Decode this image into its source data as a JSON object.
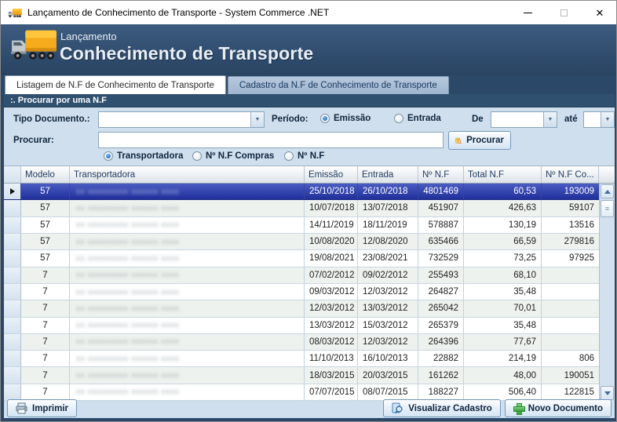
{
  "window": {
    "title": "Lançamento de Conhecimento de Transporte - System Commerce .NET",
    "close_glyph": "✕"
  },
  "banner": {
    "subtitle": "Lançamento",
    "title": "Conhecimento de Transporte"
  },
  "tabs": [
    {
      "label": "Listagem de N.F de Conhecimento de Transporte",
      "active": true
    },
    {
      "label": "Cadastro da N.F de Conhecimento de Transporte",
      "active": false
    }
  ],
  "search": {
    "section_title": ":. Procurar por uma N.F",
    "tipo_documento_label": "Tipo Documento.:",
    "tipo_documento_value": "",
    "periodo_label": "Período:",
    "periodo_options": [
      {
        "label": "Emissão",
        "selected": true
      },
      {
        "label": "Entrada",
        "selected": false
      }
    ],
    "de_label": "De",
    "de_value": "",
    "ate_label": "até",
    "ate_value": "",
    "procurar_label": "Procurar:",
    "procurar_value": "",
    "procurar_button": "Procurar",
    "filter_options": [
      {
        "label": "Transportadora",
        "selected": true
      },
      {
        "label": "Nº N.F Compras",
        "selected": false
      },
      {
        "label": "Nº N.F",
        "selected": false
      }
    ]
  },
  "grid": {
    "columns": {
      "modelo": "Modelo",
      "transportadora": "Transportadora",
      "emissao": "Emissão",
      "entrada": "Entrada",
      "nf": "Nº N.F",
      "total": "Total N.F",
      "nf_compras": "Nº N.F Co..."
    },
    "transportadora_redaction_note": "names blurred in source image",
    "redaction_placeholder": "xx xxxxxxxxx xxxxxx xxxx",
    "rows": [
      {
        "modelo": "57",
        "emissao": "25/10/2018",
        "entrada": "26/10/2018",
        "nf": "4801469",
        "total": "60,53",
        "nf_compras": "193009",
        "selected": true
      },
      {
        "modelo": "57",
        "emissao": "10/07/2018",
        "entrada": "13/07/2018",
        "nf": "451907",
        "total": "426,63",
        "nf_compras": "59107"
      },
      {
        "modelo": "57",
        "emissao": "14/11/2019",
        "entrada": "18/11/2019",
        "nf": "578887",
        "total": "130,19",
        "nf_compras": "13516"
      },
      {
        "modelo": "57",
        "emissao": "10/08/2020",
        "entrada": "12/08/2020",
        "nf": "635466",
        "total": "66,59",
        "nf_compras": "279816"
      },
      {
        "modelo": "57",
        "emissao": "19/08/2021",
        "entrada": "23/08/2021",
        "nf": "732529",
        "total": "73,25",
        "nf_compras": "97925"
      },
      {
        "modelo": "7",
        "emissao": "07/02/2012",
        "entrada": "09/02/2012",
        "nf": "255493",
        "total": "68,10",
        "nf_compras": ""
      },
      {
        "modelo": "7",
        "emissao": "09/03/2012",
        "entrada": "12/03/2012",
        "nf": "264827",
        "total": "35,48",
        "nf_compras": ""
      },
      {
        "modelo": "7",
        "emissao": "12/03/2012",
        "entrada": "13/03/2012",
        "nf": "265042",
        "total": "70,01",
        "nf_compras": ""
      },
      {
        "modelo": "7",
        "emissao": "13/03/2012",
        "entrada": "15/03/2012",
        "nf": "265379",
        "total": "35,48",
        "nf_compras": ""
      },
      {
        "modelo": "7",
        "emissao": "08/03/2012",
        "entrada": "12/03/2012",
        "nf": "264396",
        "total": "77,67",
        "nf_compras": ""
      },
      {
        "modelo": "7",
        "emissao": "11/10/2013",
        "entrada": "16/10/2013",
        "nf": "22882",
        "total": "214,19",
        "nf_compras": "806"
      },
      {
        "modelo": "7",
        "emissao": "18/03/2015",
        "entrada": "20/03/2015",
        "nf": "161262",
        "total": "48,00",
        "nf_compras": "190051"
      },
      {
        "modelo": "7",
        "emissao": "07/07/2015",
        "entrada": "08/07/2015",
        "nf": "188227",
        "total": "506,40",
        "nf_compras": "122815"
      }
    ],
    "scrollbar": {
      "thumb_grip": "≡"
    }
  },
  "footer": {
    "imprimir": "Imprimir",
    "visualizar_cadastro": "Visualizar Cadastro",
    "novo_documento": "Novo Documento"
  },
  "colors": {
    "banner_bg": "#2e4a6b",
    "section_bar_bg": "#30506f",
    "panel_bg": "#cfdfed",
    "selected_row": "#202f9a",
    "alt_row": "#eef2ee",
    "accent_blue": "#3a6ea5",
    "truck_yellow": "#f5ab1c"
  }
}
